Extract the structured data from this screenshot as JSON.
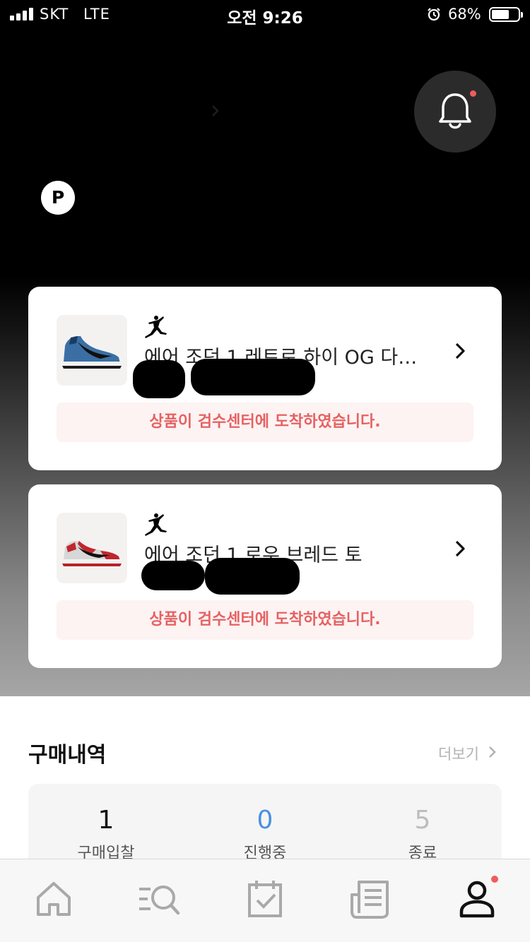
{
  "status_bar": {
    "carrier": "SKT",
    "network": "LTE",
    "time": "오전 9:26",
    "battery": "68%",
    "battery_level": 0.68
  },
  "header": {
    "notification_has_badge": true,
    "point_badge": "P"
  },
  "orders": [
    {
      "brand_icon": "jordan-jumpman-icon",
      "product_name": "에어 조던 1 레트로 하이 OG 다크...",
      "status_notice": "상품이 검수센터에 도착하였습니다.",
      "sneaker_color": "#3a6fa5"
    },
    {
      "brand_icon": "jordan-jumpman-icon",
      "product_name": "에어 조던 1 로우 브레드 토",
      "status_notice": "상품이 검수센터에 도착하였습니다.",
      "sneaker_color": "#c0262d"
    }
  ],
  "purchase_history": {
    "title": "구매내역",
    "more_label": "더보기",
    "stats": [
      {
        "count": "1",
        "label": "구매입찰",
        "color": "#111111"
      },
      {
        "count": "0",
        "label": "진행중",
        "color": "#4a90e2"
      },
      {
        "count": "5",
        "label": "종료",
        "color": "#bdbdbd"
      }
    ]
  },
  "tab_bar": {
    "tabs": [
      "home-icon",
      "search-icon",
      "calendar-check-icon",
      "news-icon",
      "profile-icon"
    ],
    "active_tab": "profile-icon",
    "profile_has_badge": true
  },
  "colors": {
    "accent_red": "#e66262",
    "notice_bg": "#fdf3f3",
    "badge_red": "#f05c5c"
  }
}
